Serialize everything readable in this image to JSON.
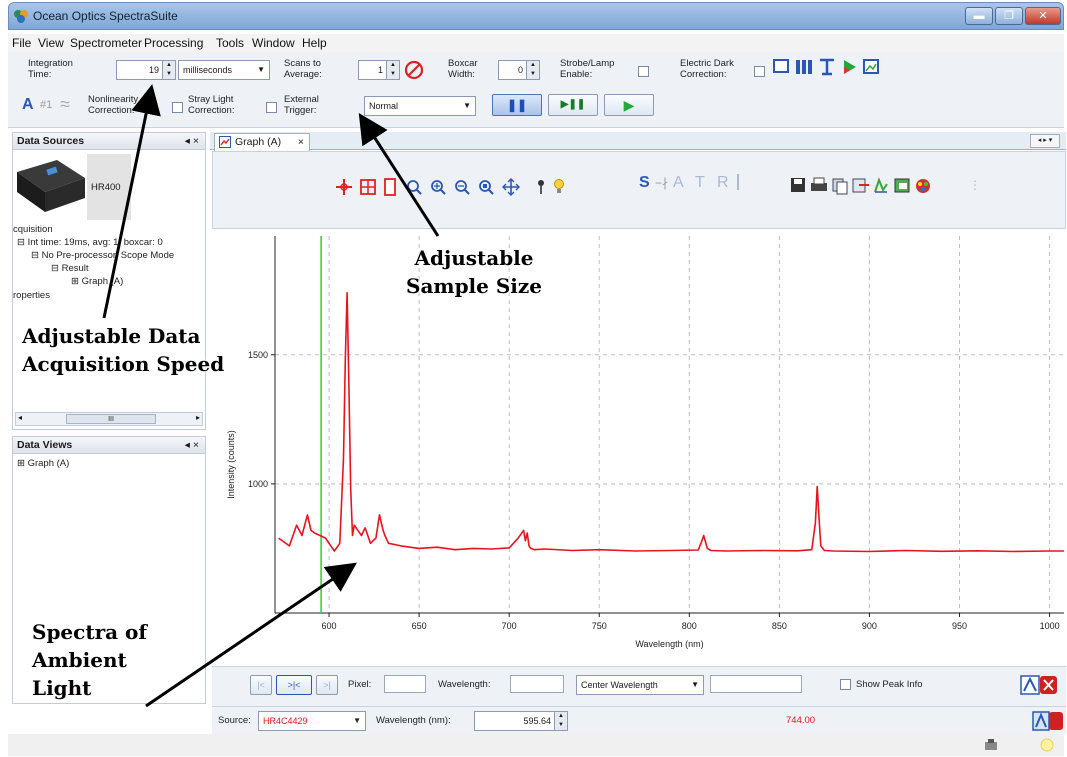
{
  "window": {
    "title": "Ocean Optics SpectraSuite",
    "controls": [
      "▬",
      "❐",
      "✕"
    ]
  },
  "menu": [
    "File",
    "View",
    "Spectrometer",
    "Processing",
    "Tools",
    "Window",
    "Help"
  ],
  "toolbar": {
    "integration_time_label": "Integration\nTime:",
    "integration_time_value": "19",
    "integration_time_unit": "milliseconds",
    "scans_label": "Scans to\nAverage:",
    "scans_value": "1",
    "boxcar_label": "Boxcar\nWidth:",
    "boxcar_value": "0",
    "strobe_label": "Strobe/Lamp\nEnable:",
    "electric_dark_label": "Electric Dark\nCorrection:",
    "nonlinearity_label": "Nonlinearity\nCorrection:",
    "stray_light_label": "Stray Light\nCorrection:",
    "external_trigger_label": "External\nTrigger:",
    "trigger_mode": "Normal",
    "a_glyph": "A",
    "hash_glyph": "#1",
    "approx_glyph": "≈",
    "pause_glyph": "❚❚",
    "step_glyph": "▶❚❚",
    "play_glyph": "▶"
  },
  "data_sources": {
    "title": "Data Sources",
    "device_label": "HR400",
    "tree": [
      "cquisition",
      "⊟ Int time: 19ms, avg: 1, boxcar: 0",
      "⊟ No Pre-processor, Scope Mode",
      "⊟ Result",
      "⊞ Graph (A)",
      "roperties"
    ],
    "scroll_mid": "III"
  },
  "data_views": {
    "title": "Data Views",
    "items": [
      "⊞ Graph (A)"
    ]
  },
  "panel_controls": "◂ ×",
  "graph_tab": {
    "label": "Graph (A)",
    "close": "×"
  },
  "graph_toolbar": {
    "letters": [
      "S",
      "A",
      "T",
      "R"
    ]
  },
  "annotations": {
    "speed": "Adjustable Data\nAcquisition Speed",
    "sample": "Adjustable\nSample Size",
    "spectra": "Spectra of\nAmbient\nLight"
  },
  "bottom": {
    "nav_buttons": [
      "|<",
      ">|<",
      ">|"
    ],
    "pixel_label": "Pixel:",
    "wavelength_label": "Wavelength:",
    "center_wavelength": "Center Wavelength",
    "show_peak_label": "Show Peak Info",
    "source_label": "Source:",
    "source_value": "HR4C4429",
    "wavelength_nm_label": "Wavelength (nm):",
    "wavelength_nm_value": "595.64",
    "intensity_readout": "744.00"
  },
  "colors": {
    "spectrum": "#e8141c",
    "cursor": "#2fcc2f",
    "annotation_text": "#000000"
  },
  "chart_data": {
    "type": "line",
    "xlabel": "Wavelength (nm)",
    "ylabel": "Intensity (counts)",
    "xlim": [
      570,
      1008
    ],
    "ylim": [
      500,
      1960
    ],
    "xticks": [
      600,
      650,
      700,
      750,
      800,
      850,
      900,
      950,
      1000
    ],
    "yticks": [
      1000,
      1500
    ],
    "grid": true,
    "cursor_x": 595.6,
    "series": [
      {
        "x": [
          572,
          578,
          582,
          585,
          588,
          590,
          592,
          595,
          598,
          601,
          603,
          606,
          608,
          609,
          610,
          611,
          612,
          613,
          614,
          616,
          618,
          620,
          623,
          626,
          628,
          630,
          631,
          633,
          640,
          650,
          660,
          670,
          680,
          690,
          700,
          705,
          708,
          709,
          710,
          711,
          712,
          714,
          720,
          735,
          750,
          770,
          790,
          805,
          807,
          808,
          810,
          812,
          820,
          840,
          860,
          868,
          870,
          871,
          872,
          873,
          875,
          880,
          900,
          920,
          940,
          960,
          980,
          1000,
          1008
        ],
        "y": [
          790,
          760,
          840,
          800,
          880,
          820,
          810,
          800,
          790,
          760,
          740,
          770,
          1100,
          1480,
          1740,
          1380,
          980,
          800,
          840,
          820,
          800,
          830,
          770,
          790,
          880,
          820,
          800,
          770,
          760,
          750,
          755,
          745,
          750,
          748,
          752,
          790,
          820,
          780,
          810,
          760,
          750,
          745,
          748,
          742,
          745,
          740,
          742,
          744,
          780,
          800,
          750,
          742,
          740,
          742,
          741,
          745,
          850,
          990,
          870,
          760,
          742,
          740,
          738,
          742,
          739,
          741,
          738,
          740,
          740
        ]
      }
    ]
  }
}
